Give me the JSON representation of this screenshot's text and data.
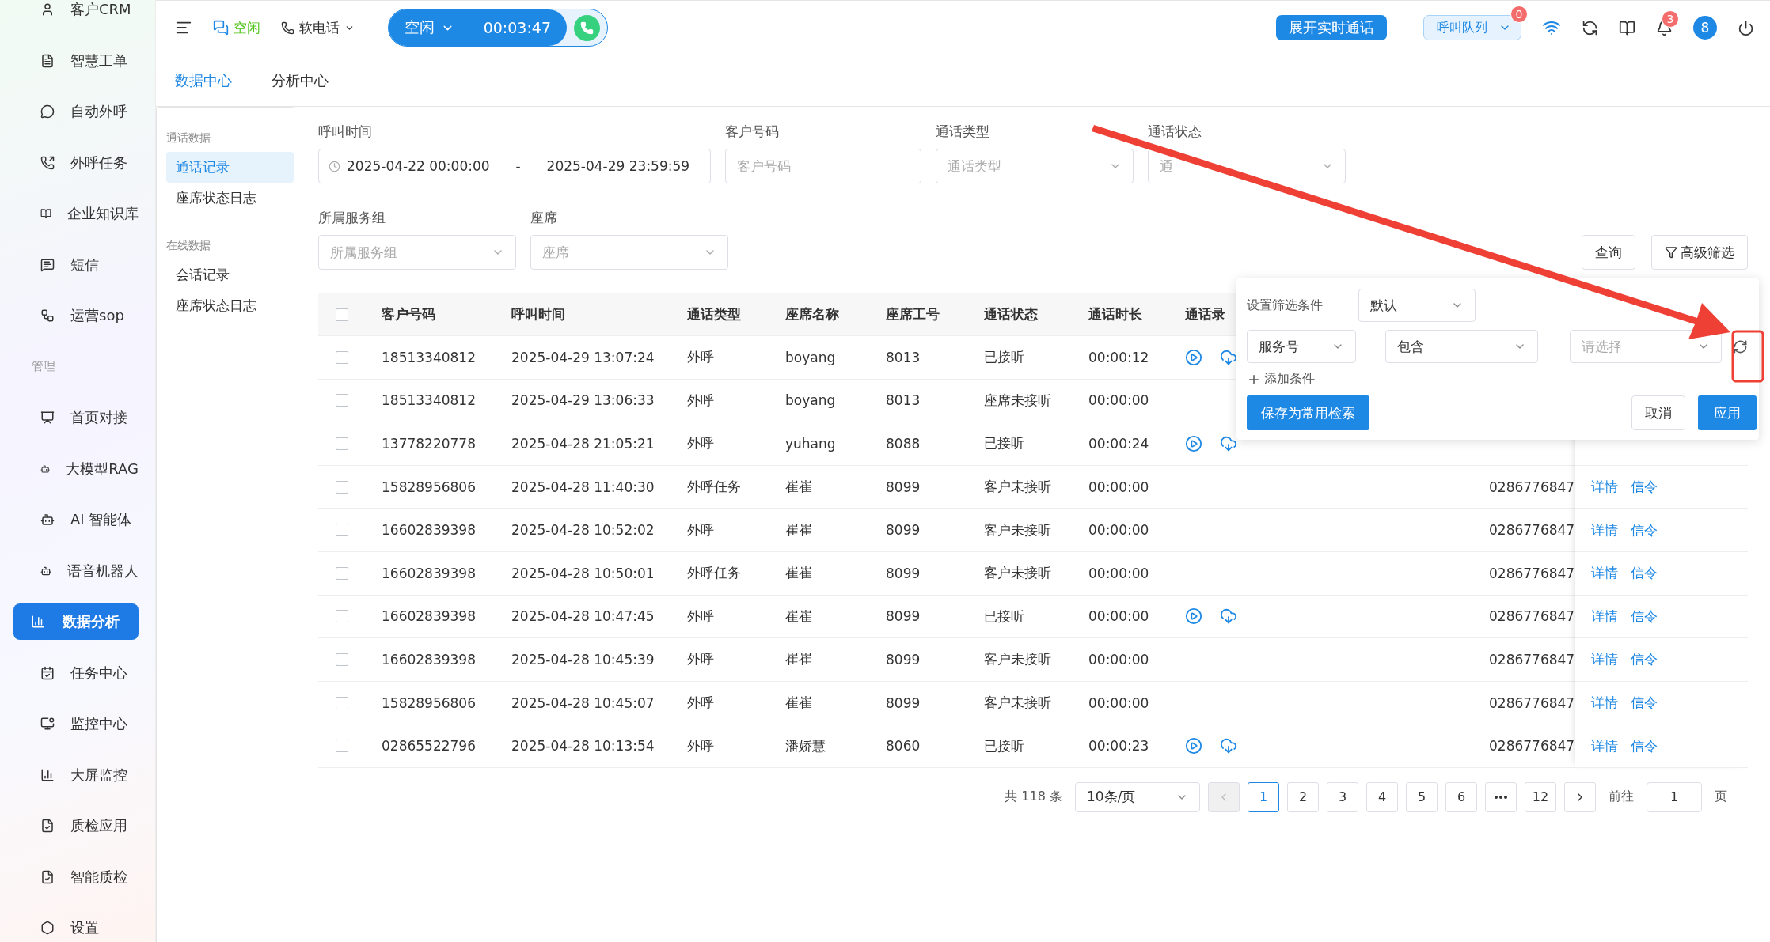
{
  "topbar": {
    "presence": "空闲",
    "softphone": "软电话",
    "call_state": "空闲",
    "timer": "00:03:47",
    "realtime_button": "展开实时通话",
    "queue": {
      "label": "呼叫队列",
      "badge": "0"
    },
    "notifications_badge": "3",
    "avatar": "8"
  },
  "sidebar": {
    "items": [
      {
        "kind": "item",
        "label": "客户CRM",
        "selected": false
      },
      {
        "kind": "item",
        "label": "智慧工单",
        "selected": false
      },
      {
        "kind": "item",
        "label": "自动外呼",
        "selected": false
      },
      {
        "kind": "item",
        "label": "外呼任务",
        "selected": false
      },
      {
        "kind": "item",
        "label": "企业知识库",
        "selected": false
      },
      {
        "kind": "item",
        "label": "短信",
        "selected": false
      },
      {
        "kind": "item",
        "label": "运营sop",
        "selected": false
      },
      {
        "kind": "section",
        "label": "管理"
      },
      {
        "kind": "item",
        "label": "首页对接",
        "selected": false
      },
      {
        "kind": "item",
        "label": "大模型RAG",
        "selected": false
      },
      {
        "kind": "item",
        "label": "AI 智能体",
        "selected": false
      },
      {
        "kind": "item",
        "label": "语音机器人",
        "selected": false
      },
      {
        "kind": "item",
        "label": "数据分析",
        "selected": true
      },
      {
        "kind": "item",
        "label": "任务中心",
        "selected": false
      },
      {
        "kind": "item",
        "label": "监控中心",
        "selected": false
      },
      {
        "kind": "item",
        "label": "大屏监控",
        "selected": false
      },
      {
        "kind": "item",
        "label": "质检应用",
        "selected": false
      },
      {
        "kind": "item",
        "label": "智能质检",
        "selected": false
      },
      {
        "kind": "item",
        "label": "设置",
        "selected": false
      }
    ]
  },
  "tabs": [
    {
      "label": "数据中心",
      "selected": true
    },
    {
      "label": "分析中心",
      "selected": false
    }
  ],
  "subnav": [
    {
      "title": "通话数据",
      "items": [
        {
          "label": "通话记录",
          "selected": true
        },
        {
          "label": "座席状态日志",
          "selected": false
        }
      ]
    },
    {
      "title": "在线数据",
      "items": [
        {
          "label": "会话记录",
          "selected": false
        },
        {
          "label": "座席状态日志",
          "selected": false
        }
      ]
    }
  ],
  "filter_rows": [
    [
      {
        "kind": "date_range",
        "label": "呼叫时间",
        "start": "2025-04-22 00:00:00",
        "separator": "-",
        "end": "2025-04-29 23:59:59"
      },
      {
        "kind": "input",
        "label": "客户号码",
        "placeholder": "客户号码"
      },
      {
        "kind": "select",
        "label": "通话类型",
        "placeholder": "通话类型"
      },
      {
        "kind": "select",
        "label": "通话状态",
        "placeholder": "通"
      }
    ],
    [
      {
        "kind": "select",
        "label": "所属服务组",
        "placeholder": "所属服务组"
      },
      {
        "kind": "select",
        "label": "座席",
        "placeholder": "座席"
      }
    ]
  ],
  "filter_buttons": [
    {
      "kind": "plain",
      "label": "查询"
    },
    {
      "kind": "filter",
      "label": "高级筛选"
    }
  ],
  "advanced_filter": {
    "title": "设置筛选条件",
    "preset": "默认",
    "field": "服务号",
    "operator": "包含",
    "value_placeholder": "请选择",
    "add_label": "添加条件",
    "save_button": "保存为常用检索",
    "cancel_button": "取消",
    "apply_button": "应用"
  },
  "table": {
    "all_checked": false,
    "columns": [
      "客户号码",
      "呼叫时间",
      "通话类型",
      "座席名称",
      "座席工号",
      "通话状态",
      "通话时长",
      "通话录"
    ],
    "rows": [
      {
        "checked": false,
        "cells": [
          "18513340812",
          "2025-04-29 13:07:24",
          "外呼",
          "boyang",
          "8013",
          "已接听",
          "00:00:12"
        ],
        "recording": true
      },
      {
        "checked": false,
        "cells": [
          "18513340812",
          "2025-04-29 13:06:33",
          "外呼",
          "boyang",
          "8013",
          "座席未接听",
          "00:00:00"
        ],
        "recording": false
      },
      {
        "checked": false,
        "cells": [
          "13778220778",
          "2025-04-28 21:05:21",
          "外呼",
          "yuhang",
          "8088",
          "已接听",
          "00:00:24"
        ],
        "recording": true
      },
      {
        "checked": false,
        "cells": [
          "15828956806",
          "2025-04-28 11:40:30",
          "外呼任务",
          "崔崔",
          "8099",
          "客户未接听",
          "00:00:00"
        ],
        "recording": false,
        "service_number": "0286776847",
        "actions": [
          "详情",
          "信令"
        ]
      },
      {
        "checked": false,
        "cells": [
          "16602839398",
          "2025-04-28 10:52:02",
          "外呼",
          "崔崔",
          "8099",
          "客户未接听",
          "00:00:00"
        ],
        "recording": false,
        "service_number": "0286776847",
        "actions": [
          "详情",
          "信令"
        ]
      },
      {
        "checked": false,
        "cells": [
          "16602839398",
          "2025-04-28 10:50:01",
          "外呼任务",
          "崔崔",
          "8099",
          "客户未接听",
          "00:00:00"
        ],
        "recording": false,
        "service_number": "0286776847",
        "actions": [
          "详情",
          "信令"
        ]
      },
      {
        "checked": false,
        "cells": [
          "16602839398",
          "2025-04-28 10:47:45",
          "外呼",
          "崔崔",
          "8099",
          "已接听",
          "00:00:00"
        ],
        "recording": true,
        "service_number": "0286776847",
        "actions": [
          "详情",
          "信令"
        ]
      },
      {
        "checked": false,
        "cells": [
          "16602839398",
          "2025-04-28 10:45:39",
          "外呼",
          "崔崔",
          "8099",
          "客户未接听",
          "00:00:00"
        ],
        "recording": false,
        "service_number": "0286776847",
        "actions": [
          "详情",
          "信令"
        ]
      },
      {
        "checked": false,
        "cells": [
          "15828956806",
          "2025-04-28 10:45:07",
          "外呼",
          "崔崔",
          "8099",
          "客户未接听",
          "00:00:00"
        ],
        "recording": false,
        "service_number": "0286776847",
        "actions": [
          "详情",
          "信令"
        ]
      },
      {
        "checked": false,
        "cells": [
          "02865522796",
          "2025-04-28 10:13:54",
          "外呼",
          "潘娇慧",
          "8060",
          "已接听",
          "00:00:23"
        ],
        "recording": true,
        "service_number": "0286776847",
        "actions": [
          "详情",
          "信令"
        ]
      }
    ]
  },
  "pagination": {
    "total": "共 118 条",
    "page_size": "10条/页",
    "prev_disabled": true,
    "pages": [
      {
        "kind": "page",
        "label": "1",
        "selected": true
      },
      {
        "kind": "page",
        "label": "2",
        "selected": false
      },
      {
        "kind": "page",
        "label": "3",
        "selected": false
      },
      {
        "kind": "page",
        "label": "4",
        "selected": false
      },
      {
        "kind": "page",
        "label": "5",
        "selected": false
      },
      {
        "kind": "page",
        "label": "6",
        "selected": false
      },
      {
        "kind": "more",
        "selected": false
      },
      {
        "kind": "page",
        "label": "12",
        "selected": false
      }
    ],
    "goto_label": "前往",
    "goto_value": "1",
    "goto_suffix": "页"
  },
  "annotation": {
    "kind": "arrow_to_highlight"
  }
}
